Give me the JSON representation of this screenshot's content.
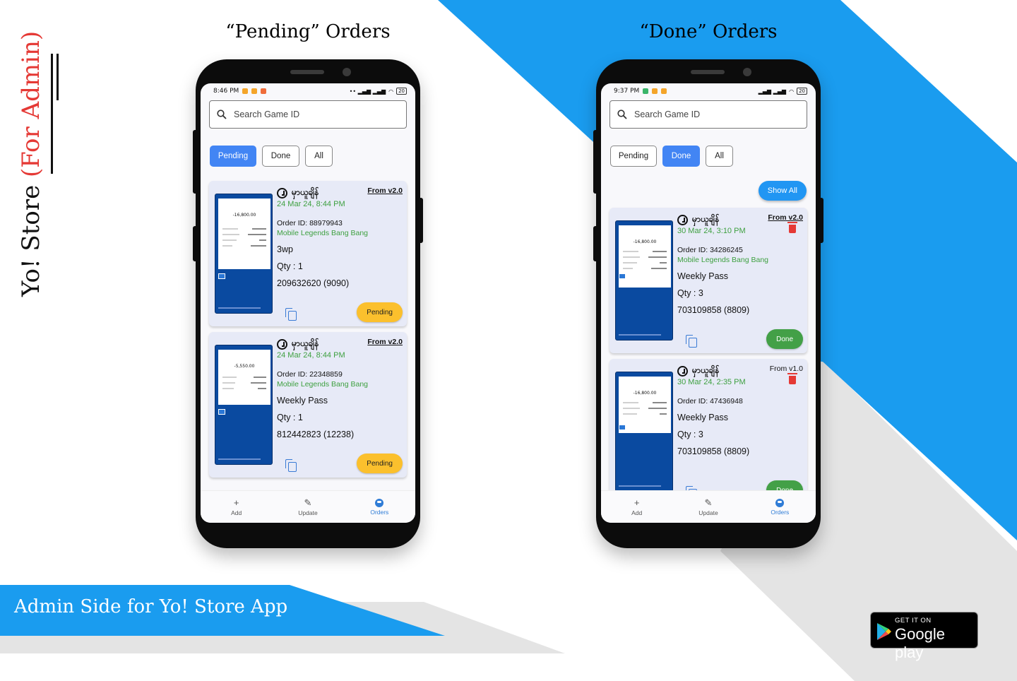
{
  "side_title": {
    "main": "Yo! Store",
    "accent": "(For Admin)"
  },
  "captions": {
    "pending": "“Pending” Orders",
    "done": "“Done” Orders"
  },
  "colors": {
    "accent_blue": "#1a9cef",
    "gray_band": "#e4e4e4",
    "pending_badge": "#fbc02d",
    "done_badge": "#43a047",
    "green_text": "#3ea040",
    "chip_active": "#4285f4"
  },
  "left_phone": {
    "status": {
      "time": "8:46 PM",
      "right": "••  ▂▄▆ ▂▄▆",
      "battery": "20"
    },
    "search_placeholder": "Search Game ID",
    "filters": {
      "pending": "Pending",
      "done": "Done",
      "all": "All"
    },
    "cards": [
      {
        "name": "မှာယူချိန်",
        "from": "From v2.0",
        "date": "24 Mar 24, 8:44 PM",
        "order_id": "Order ID: 88979943",
        "game": "Mobile Legends Bang Bang",
        "item": "3wp",
        "qty": "Qty : 1",
        "player": "209632620 (9090)",
        "status": "Pending",
        "receipt_amount": "-16,800.00"
      },
      {
        "name": "မှာယူချိန်",
        "from": "From v2.0",
        "date": "24 Mar 24, 8:44 PM",
        "order_id": "Order ID: 22348859",
        "game": "Mobile Legends Bang Bang",
        "item": "Weekly Pass",
        "qty": "Qty : 1",
        "player": "812442823 (12238)",
        "status": "Pending",
        "receipt_amount": "-5,550.00"
      }
    ],
    "nav": {
      "add": "Add",
      "update": "Update",
      "orders": "Orders"
    }
  },
  "right_phone": {
    "status": {
      "time": "9:37 PM",
      "right": "▂▄▆ ▂▄▆",
      "battery": "20"
    },
    "search_placeholder": "Search Game ID",
    "filters": {
      "pending": "Pending",
      "done": "Done",
      "all": "All"
    },
    "show_all": "Show All",
    "cards": [
      {
        "name": "မှာယူချိန်",
        "from": "From v2.0",
        "date": "30 Mar 24, 3:10 PM",
        "order_id": "Order ID: 34286245",
        "game": "Mobile Legends Bang Bang",
        "item": "Weekly Pass",
        "qty": "Qty : 3",
        "player": "703109858 (8809)",
        "status": "Done",
        "receipt_amount": "-16,800.00"
      },
      {
        "name": "မှာယူချိန်",
        "from": "From v1.0",
        "date": "30 Mar 24, 2:35 PM",
        "order_id": "Order ID: 47436948",
        "game": "",
        "item": "Weekly Pass",
        "qty": "Qty : 3",
        "player": "703109858 (8809)",
        "status": "Done",
        "receipt_amount": "-16,800.00"
      }
    ],
    "nav": {
      "add": "Add",
      "update": "Update",
      "orders": "Orders"
    }
  },
  "banner": "Admin Side for Yo! Store App",
  "google_play": {
    "top": "GET IT ON",
    "store": "Google play"
  }
}
